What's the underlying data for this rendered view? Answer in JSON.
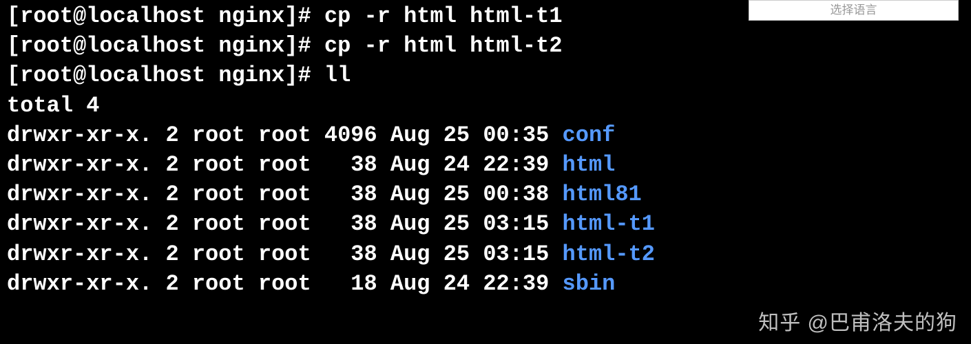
{
  "dropdown": {
    "label": "选择语言"
  },
  "prompt": {
    "user": "root",
    "host": "localhost",
    "cwd": "nginx",
    "symbol": "#"
  },
  "commands": [
    "cp -r html html-t1",
    "cp -r html html-t2",
    "ll"
  ],
  "listing": {
    "total": "total 4",
    "entries": [
      {
        "perms": "drwxr-xr-x.",
        "links": "2",
        "owner": "root",
        "group": "root",
        "size": "4096",
        "date": "Aug 25 00:35",
        "name": "conf"
      },
      {
        "perms": "drwxr-xr-x.",
        "links": "2",
        "owner": "root",
        "group": "root",
        "size": "  38",
        "date": "Aug 24 22:39",
        "name": "html"
      },
      {
        "perms": "drwxr-xr-x.",
        "links": "2",
        "owner": "root",
        "group": "root",
        "size": "  38",
        "date": "Aug 25 00:38",
        "name": "html81"
      },
      {
        "perms": "drwxr-xr-x.",
        "links": "2",
        "owner": "root",
        "group": "root",
        "size": "  38",
        "date": "Aug 25 03:15",
        "name": "html-t1"
      },
      {
        "perms": "drwxr-xr-x.",
        "links": "2",
        "owner": "root",
        "group": "root",
        "size": "  38",
        "date": "Aug 25 03:15",
        "name": "html-t2"
      },
      {
        "perms": "drwxr-xr-x.",
        "links": "2",
        "owner": "root",
        "group": "root",
        "size": "  18",
        "date": "Aug 24 22:39",
        "name": "sbin"
      }
    ]
  },
  "watermark": "知乎 @巴甫洛夫的狗"
}
